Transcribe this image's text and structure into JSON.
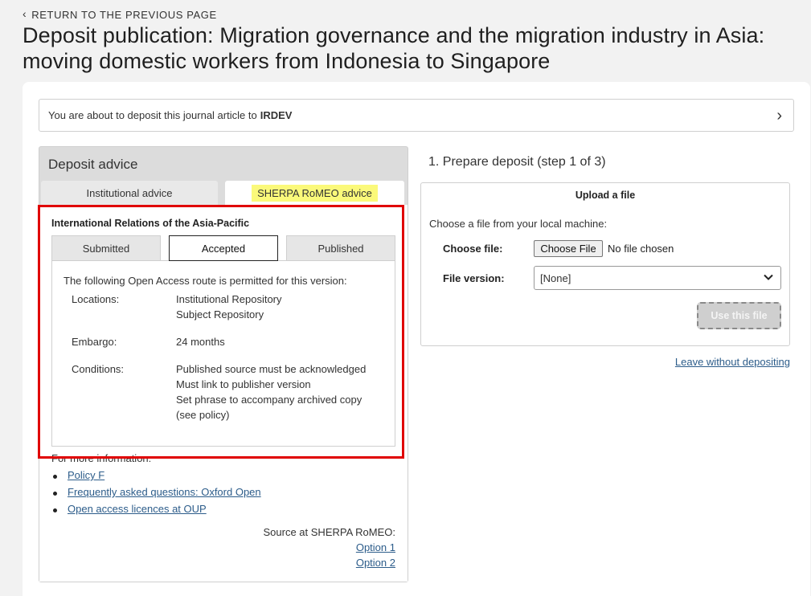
{
  "back": {
    "label": "RETURN TO THE PREVIOUS PAGE"
  },
  "title": "Deposit publication: Migration governance and the migration industry in Asia: moving domestic workers from Indonesia to Singapore",
  "deposit_bar": {
    "prefix": "You are about to deposit this journal article to",
    "repository": "IRDEV"
  },
  "advice": {
    "heading": "Deposit advice",
    "tabs": [
      "Institutional advice",
      "SHERPA RoMEO advice"
    ],
    "journal": "International Relations of the Asia-Pacific",
    "versions": [
      "Submitted",
      "Accepted",
      "Published"
    ],
    "route_intro": "The following Open Access route is permitted for this version:",
    "locations_label": "Locations:",
    "locations": [
      "Institutional Repository",
      "Subject Repository"
    ],
    "embargo_label": "Embargo:",
    "embargo": "24 months",
    "conditions_label": "Conditions:",
    "conditions": [
      "Published source must be acknowledged",
      "Must link to publisher version",
      "Set phrase to accompany archived copy",
      "(see policy)"
    ],
    "more_info": "For more information:",
    "links": [
      "Policy F",
      "Frequently asked questions: Oxford Open",
      "Open access licences at OUP"
    ],
    "source_label": "Source at SHERPA RoMEO:",
    "options": [
      "Option 1",
      "Option 2"
    ]
  },
  "prepare": {
    "step_title": "1. Prepare deposit (step 1 of 3)",
    "upload_heading": "Upload a file",
    "choose_msg": "Choose a file from your local machine:",
    "choose_file_label": "Choose file:",
    "choose_file_button": "Choose File",
    "no_file": "No file chosen",
    "file_version_label": "File version:",
    "file_version_value": "[None]",
    "use_button": "Use this file",
    "leave_link": "Leave without depositing"
  },
  "colors": {
    "highlight_border": "#e00000",
    "sherpa_tag": "#fbf97a",
    "link": "#2c5c8a"
  }
}
